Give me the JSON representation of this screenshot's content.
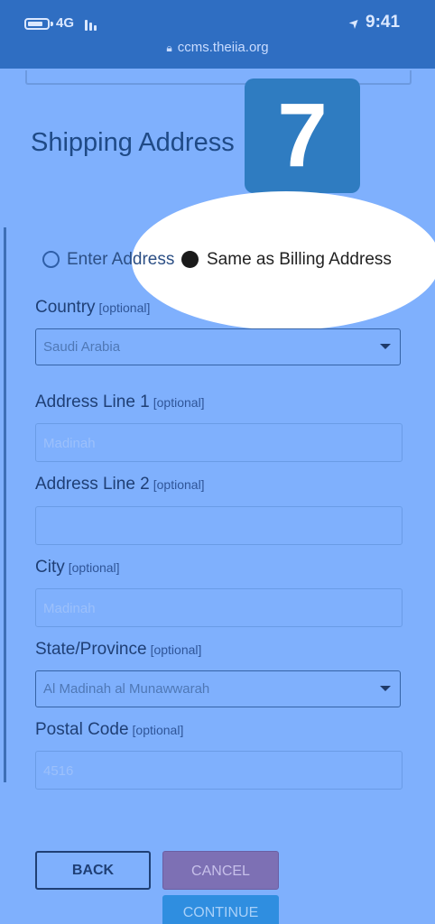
{
  "status_bar": {
    "network": "4G",
    "time": "9:41",
    "url": "ccms.theiia.org"
  },
  "page": {
    "title": "Shipping Address",
    "step_badge": "7"
  },
  "address_option": {
    "options": [
      "Enter Address",
      "Same as Billing Address"
    ],
    "selected": "Same as Billing Address"
  },
  "fields": {
    "country": {
      "label": "Country",
      "optional": "[optional]",
      "value": "Saudi Arabia"
    },
    "address1": {
      "label": "Address Line 1",
      "optional": "[optional]",
      "placeholder": "Madinah"
    },
    "address2": {
      "label": "Address Line 2",
      "optional": "[optional]",
      "placeholder": ""
    },
    "city": {
      "label": "City",
      "optional": "[optional]",
      "placeholder": "Madinah"
    },
    "state": {
      "label": "State/Province",
      "optional": "[optional]",
      "value": "Al Madinah al Munawwarah"
    },
    "postal": {
      "label": "Postal Code",
      "optional": "[optional]",
      "placeholder": "4516"
    }
  },
  "buttons": {
    "back": "BACK",
    "cancel": "CANCEL",
    "continue": "CONTINUE"
  },
  "colors": {
    "overlay": "#7fb0fd",
    "header": "#2f6ec2",
    "badge": "#2f7cc1",
    "cancel": "#7d70b4",
    "continue": "#2f8ee0"
  }
}
